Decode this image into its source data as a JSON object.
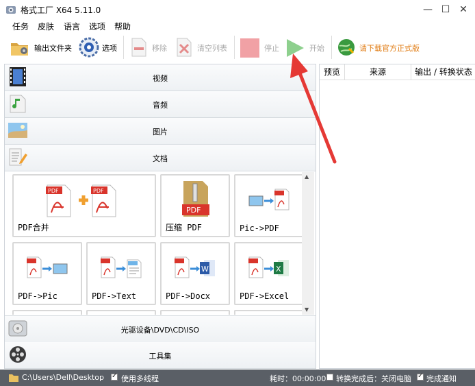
{
  "title": "格式工厂 X64 5.11.0",
  "window_controls": {
    "minimize": "—",
    "maximize": "☐",
    "close": "✕"
  },
  "menu": [
    "任务",
    "皮肤",
    "语言",
    "选项",
    "帮助"
  ],
  "toolbar": {
    "output_folder": "输出文件夹",
    "options": "选项",
    "remove": "移除",
    "clear_list": "清空列表",
    "stop": "停止",
    "start": "开始",
    "download": "请下载官方正式版"
  },
  "categories": {
    "video": "视频",
    "audio": "音频",
    "image": "图片",
    "document": "文档",
    "disc": "光驱设备\\DVD\\CD\\ISO",
    "toolbox": "工具集"
  },
  "doc_tools": [
    "PDF合并",
    "压缩 PDF",
    "Pic->PDF",
    "PDF->Pic",
    "PDF->Text",
    "PDF->Docx",
    "PDF->Excel"
  ],
  "task_columns": [
    "预览",
    "来源",
    "输出 / 转换状态"
  ],
  "status": {
    "path": "C:\\Users\\Dell\\Desktop",
    "multithread": "使用多线程",
    "elapsed": "耗时：00:00:00",
    "shutdown": "转换完成后：关闭电脑",
    "notify": "完成通知"
  },
  "colors": {
    "accent_orange": "#e07a10",
    "status_bg": "#5a5f66",
    "arrow_red": "#e53935"
  }
}
